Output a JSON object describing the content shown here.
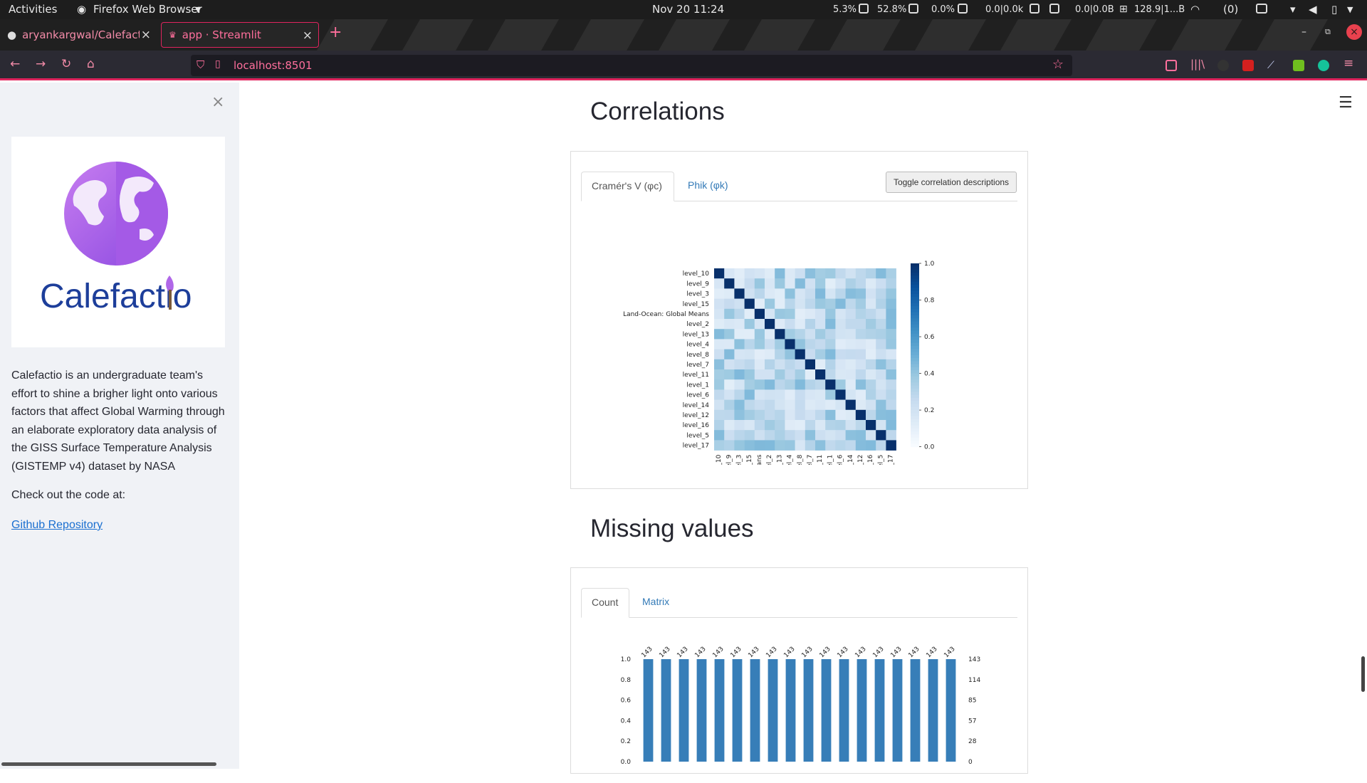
{
  "topbar": {
    "activities": "Activities",
    "app_name": "Firefox Web Browser",
    "clock": "Nov 20  11:24",
    "stats": [
      "5.3%",
      "52.8%",
      "0.0%",
      "0.0|0.0k",
      "0.0|0.0B",
      "128.9|1...B"
    ],
    "notifications": "(0)"
  },
  "browser": {
    "tabs": [
      {
        "label": "aryankargwal/Calefactio",
        "active": false
      },
      {
        "label": "app · Streamlit",
        "active": true
      }
    ],
    "url": "localhost:8501"
  },
  "sidebar": {
    "logo_text": "Calefactio",
    "description": "Calefactio is an undergraduate team's effort to shine a brigher light onto various factors that affect Global Warming through an elaborate exploratory data analysis of the GISS Surface Temperature Analysis (GISTEMP v4) dataset by NASA",
    "check_text": "Check out the code at:",
    "link_text": "Github Repository"
  },
  "main": {
    "correlations": {
      "heading": "Correlations",
      "tabs": [
        "Cramér's V (φc)",
        "Phik (φk)"
      ],
      "active_tab": 0,
      "toggle_button": "Toggle correlation descriptions"
    },
    "missing": {
      "heading": "Missing values",
      "tabs": [
        "Count",
        "Matrix"
      ],
      "active_tab": 0
    }
  },
  "chart_data": [
    {
      "type": "heatmap",
      "labels": [
        "level_10",
        "level_9",
        "level_3",
        "level_15",
        "Land-Ocean: Global Means",
        "level_2",
        "level_13",
        "level_4",
        "level_8",
        "level_7",
        "level_11",
        "level_1",
        "level_6",
        "level_14",
        "level_12",
        "level_16",
        "level_5",
        "level_17"
      ],
      "x_tick_labels": [
        "level_10",
        "level_9",
        "level_3",
        "level_15",
        "Global Means",
        "level_2",
        "level_13",
        "level_4",
        "level_8",
        "level_7",
        "level_11",
        "level_1",
        "level_6",
        "level_14",
        "level_12",
        "level_16",
        "level_5",
        "level_17"
      ],
      "colorbar_ticks": [
        "1.0",
        "0.8",
        "0.6",
        "0.4",
        "0.2",
        "0.0"
      ],
      "vmin": 0,
      "vmax": 1,
      "diagonal_value": 1.0,
      "off_diagonal_range": [
        0.1,
        0.45
      ],
      "colors": {
        "low": "#f7fbff",
        "high": "#08306b"
      }
    },
    {
      "type": "bar",
      "values": [
        143,
        143,
        143,
        143,
        143,
        143,
        143,
        143,
        143,
        143,
        143,
        143,
        143,
        143,
        143,
        143,
        143,
        143
      ],
      "bar_labels": [
        "143",
        "143",
        "143",
        "143",
        "143",
        "143",
        "143",
        "143",
        "143",
        "143",
        "143",
        "143",
        "143",
        "143",
        "143",
        "143",
        "143",
        "143"
      ],
      "left_ticks": [
        "1.0",
        "0.8",
        "0.6",
        "0.4",
        "0.2",
        "0.0"
      ],
      "right_ticks": [
        "143",
        "114",
        "85",
        "57",
        "28",
        "0"
      ],
      "ylim": [
        0,
        143
      ],
      "color": "#377eb8"
    }
  ]
}
